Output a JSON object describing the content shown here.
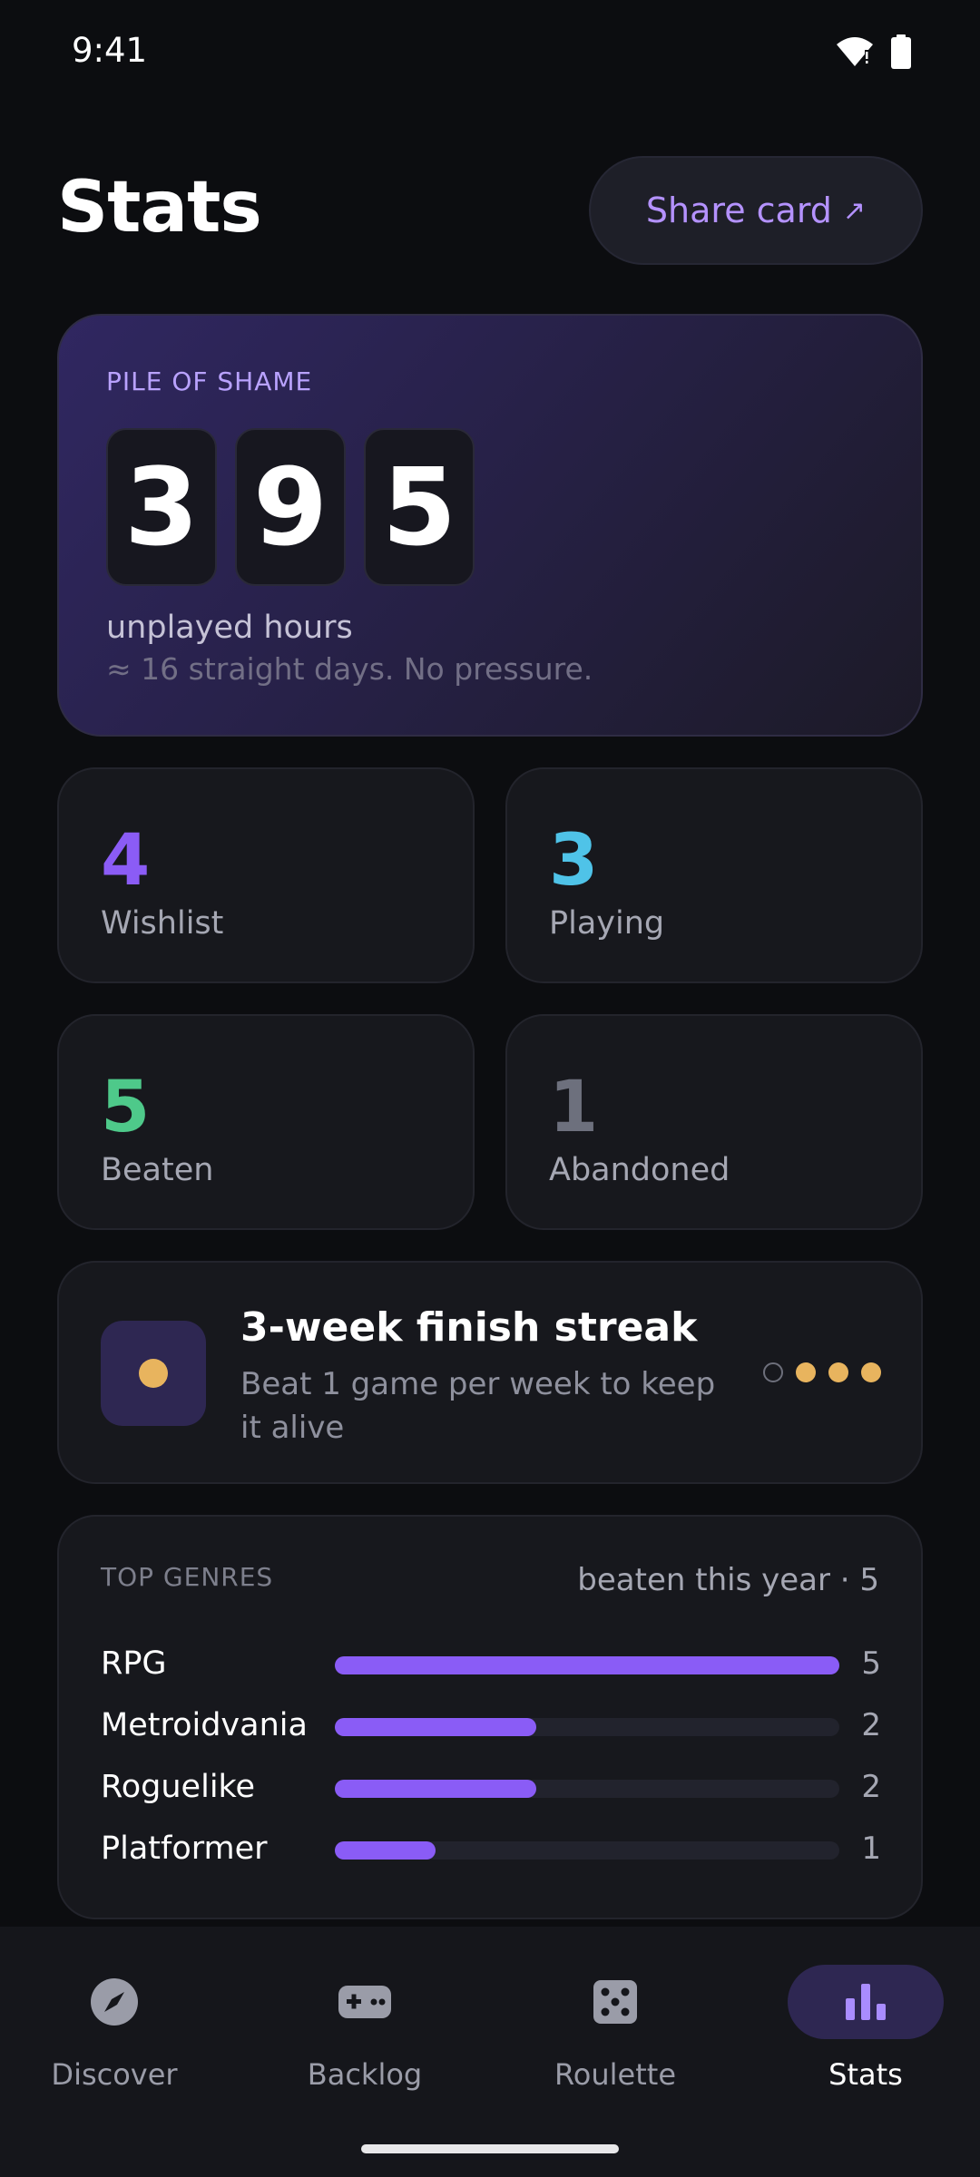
{
  "status_bar": {
    "time": "9:41"
  },
  "header": {
    "title": "Stats",
    "share_label": "Share card",
    "share_arrow": "↗"
  },
  "pile": {
    "label": "PILE OF SHAME",
    "digits": [
      "3",
      "9",
      "5"
    ],
    "unit": "unplayed hours",
    "note": "≈ 16 straight days. No pressure."
  },
  "stats": [
    {
      "value": "4",
      "label": "Wishlist",
      "color": "#8b5cf6"
    },
    {
      "value": "3",
      "label": "Playing",
      "color": "#4fc3e8"
    },
    {
      "value": "5",
      "label": "Beaten",
      "color": "#4ec98a"
    },
    {
      "value": "1",
      "label": "Abandoned",
      "color": "#6d707d"
    }
  ],
  "streak": {
    "title": "3-week finish streak",
    "description": "Beat 1 game per week to keep it alive",
    "dots": [
      "empty",
      "filled",
      "filled",
      "filled"
    ],
    "accent": "#e8b45e"
  },
  "genres": {
    "title": "TOP GENRES",
    "meta": "beaten this year · 5",
    "max": 5,
    "items": [
      {
        "name": "RPG",
        "count": 5
      },
      {
        "name": "Metroidvania",
        "count": 2
      },
      {
        "name": "Roguelike",
        "count": 2
      },
      {
        "name": "Platformer",
        "count": 1
      }
    ]
  },
  "nav": {
    "items": [
      {
        "label": "Discover",
        "icon": "compass-icon"
      },
      {
        "label": "Backlog",
        "icon": "gamepad-icon"
      },
      {
        "label": "Roulette",
        "icon": "dice-icon"
      },
      {
        "label": "Stats",
        "icon": "bar-chart-icon",
        "active": true
      }
    ]
  }
}
